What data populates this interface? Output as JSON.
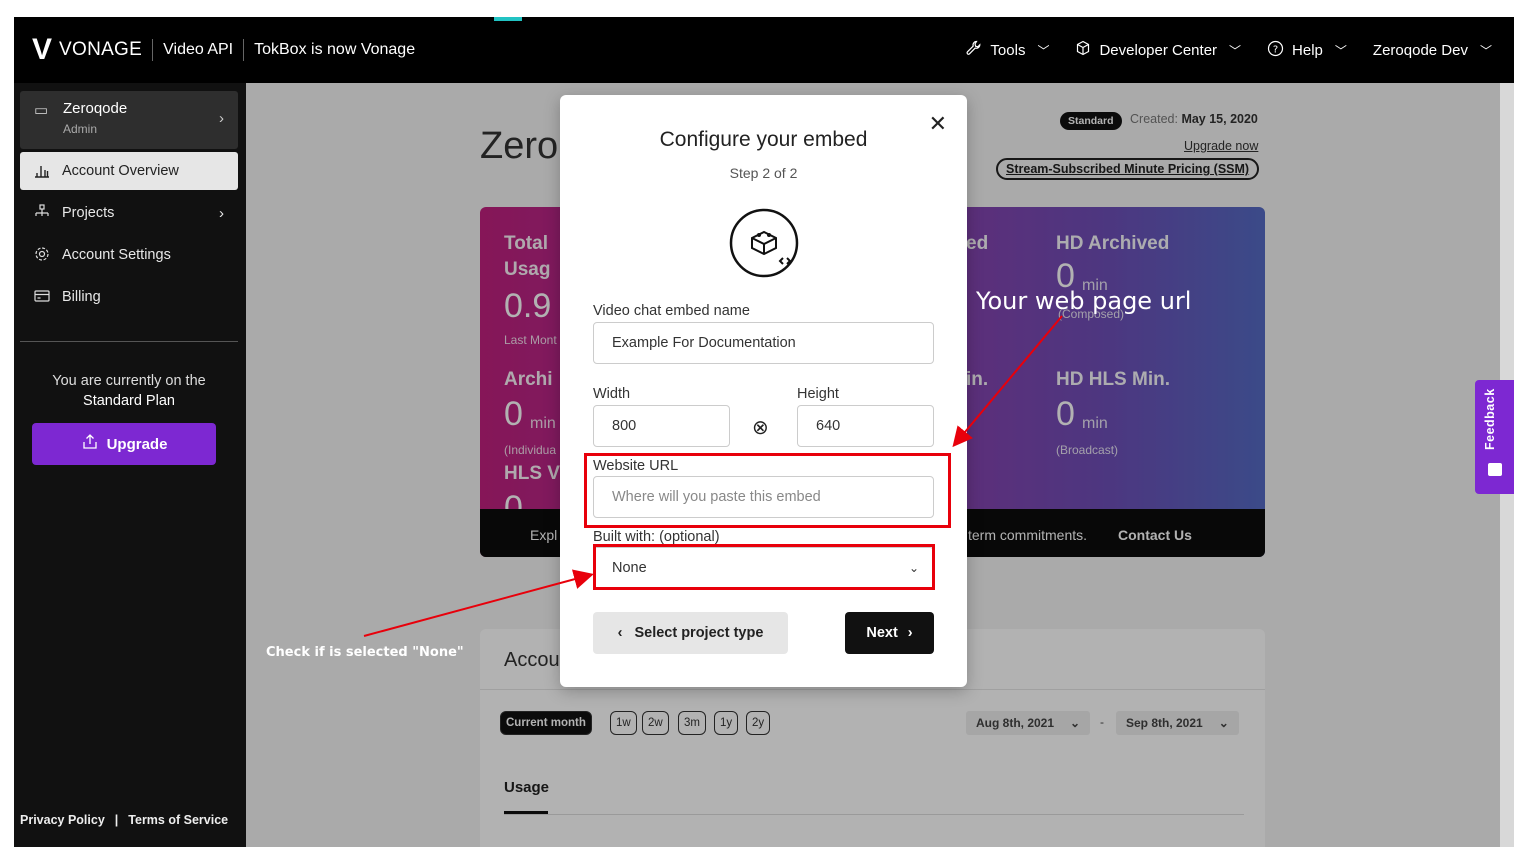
{
  "topbar": {
    "logo": "VONAGE",
    "product": "Video API",
    "tagline": "TokBox is now Vonage",
    "nav": [
      {
        "label": "Tools",
        "icon": "wrench-icon"
      },
      {
        "label": "Developer Center",
        "icon": "cube-icon"
      },
      {
        "label": "Help",
        "icon": "help-circle-icon"
      },
      {
        "label": "Zeroqode Dev",
        "icon": ""
      }
    ]
  },
  "sidebar": {
    "account": {
      "name": "Zeroqode",
      "role": "Admin"
    },
    "items": [
      {
        "label": "Account Overview",
        "icon": "bar-chart-icon",
        "active": true
      },
      {
        "label": "Projects",
        "icon": "hierarchy-icon",
        "active": false
      },
      {
        "label": "Account Settings",
        "icon": "gear-icon",
        "active": false
      },
      {
        "label": "Billing",
        "icon": "card-icon",
        "active": false
      }
    ],
    "plan_prefix": "You are currently on the",
    "plan_name": "Standard Plan",
    "upgrade_label": "Upgrade",
    "footer": {
      "privacy": "Privacy Policy",
      "divider": "|",
      "terms": "Terms of Service"
    }
  },
  "main": {
    "title": "Zero",
    "badge": "Standard",
    "created_label": "Created:",
    "created_date": "May 15, 2020",
    "upgrade_now": "Upgrade now",
    "ssm": "Stream-Subscribed Minute Pricing (SSM)",
    "stats": {
      "total_label_1": "Total",
      "total_label_2": "Usag",
      "total_value": "0.9",
      "last_month": "Last Mont",
      "archived_label": "Archi",
      "archived_value": "0",
      "unit": "min",
      "individual": "(Individua",
      "hls_label": "HLS V",
      "hls_value": "0",
      "ed_fragment": "ed",
      "hd_archived_label": "HD Archived",
      "hd_archived_value": "0",
      "composed": "(Composed)",
      "in_fragment": "in.",
      "hd_hls_label": "HD HLS Min.",
      "hd_hls_value": "0",
      "broadcast": "(Broadcast)",
      "explore": "Expl",
      "commit": "term commitments.",
      "contact": "Contact Us"
    },
    "account_panel": {
      "title": "Accou",
      "ranges": [
        "Current month",
        "1w",
        "2w",
        "3m",
        "1y",
        "2y"
      ],
      "date_from": "Aug 8th, 2021",
      "date_sep": "-",
      "date_to": "Sep 8th, 2021",
      "usage_tab": "Usage"
    }
  },
  "feedback": "Feedback",
  "modal": {
    "title": "Configure your embed",
    "step": "Step 2 of 2",
    "name_label": "Video chat embed name",
    "name_value": "Example For Documentation",
    "width_label": "Width",
    "width_value": "800",
    "height_label": "Height",
    "height_value": "640",
    "url_label": "Website URL",
    "url_placeholder": "Where will you paste this embed",
    "built_label": "Built with: (optional)",
    "built_value": "None",
    "back_label": "Select project type",
    "next_label": "Next"
  },
  "annotations": {
    "url_note": "Your web page url",
    "none_note": "Check if is selected \"None\"",
    "color": "#e8000b"
  }
}
